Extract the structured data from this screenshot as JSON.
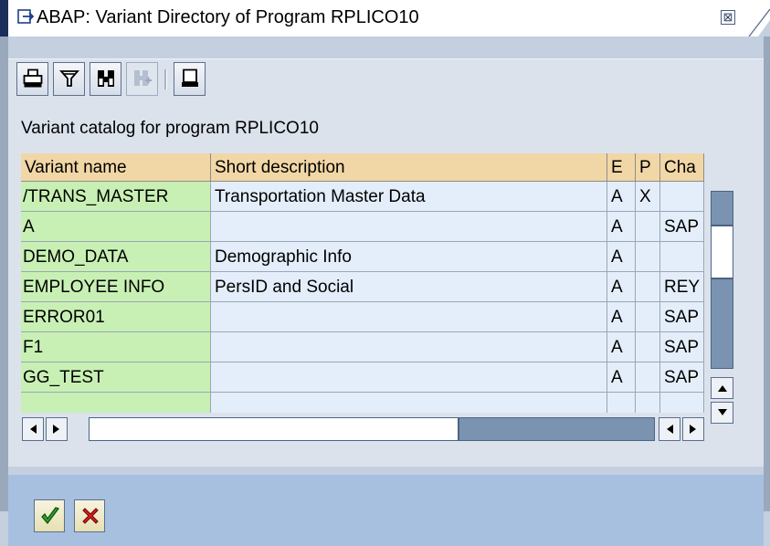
{
  "window": {
    "title": "ABAP: Variant Directory of Program RPLICO10",
    "close_glyph": "⊠"
  },
  "toolbar": {
    "buttons": [
      {
        "icon": "print-icon",
        "enabled": true
      },
      {
        "icon": "filter-icon",
        "enabled": true
      },
      {
        "icon": "find-icon",
        "enabled": true
      },
      {
        "icon": "find-next-icon",
        "enabled": false
      },
      {
        "icon": "page-icon",
        "enabled": true
      }
    ]
  },
  "catalog_label": "Variant catalog for program RPLICO10",
  "grid": {
    "columns": [
      "Variant name",
      "Short description",
      "E",
      "P",
      "Cha"
    ],
    "rows": [
      [
        "/TRANS_MASTER",
        "Transportation Master Data",
        "A",
        "X",
        ""
      ],
      [
        "A",
        "",
        "A",
        "",
        "SAP"
      ],
      [
        "DEMO_DATA",
        "Demographic Info",
        "A",
        "",
        ""
      ],
      [
        "EMPLOYEE INFO",
        "PersID and Social",
        "A",
        "",
        "REY"
      ],
      [
        "ERROR01",
        "",
        "A",
        "",
        "SAP"
      ],
      [
        "F1",
        "",
        "A",
        "",
        "SAP"
      ],
      [
        "GG_TEST",
        "",
        "A",
        "",
        "SAP"
      ],
      [
        "",
        "",
        "",
        "",
        ""
      ]
    ]
  },
  "footer": {
    "confirm_icon": "checkmark-icon",
    "cancel_icon": "cancel-icon"
  },
  "colors": {
    "header_bg": "#f2d7a6",
    "key_cell_bg": "#c8f0b4",
    "data_cell_bg": "#e4eefa",
    "dialog_bg": "#c4d0e0",
    "footer_bg": "#a7c0e0"
  }
}
